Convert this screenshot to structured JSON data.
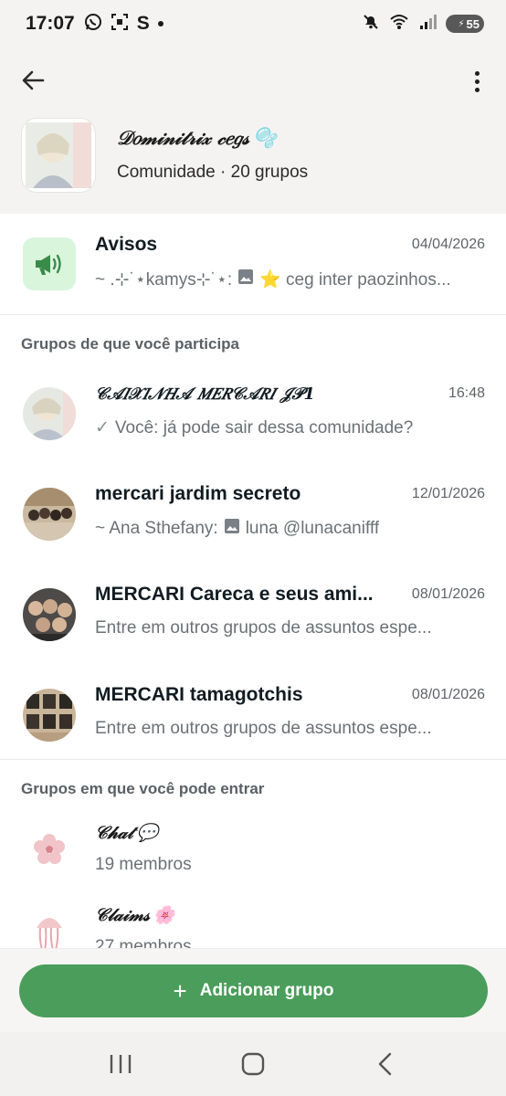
{
  "status_bar": {
    "time": "17:07",
    "left_icons": [
      "whatsapp-icon",
      "screenshot-icon",
      "s-icon",
      "dot-icon"
    ],
    "s_label": "S",
    "right_icons": [
      "mute-icon",
      "wifi-icon",
      "signal-icon"
    ],
    "battery": "55"
  },
  "header": {
    "community_name": "𝒟𝑜𝓂𝒾𝓃𝒾𝓉𝓇𝒾𝓍 𝒸𝑒𝑔𝓈",
    "community_emoji": "🫧",
    "subtitle": "Comunidade · 20 grupos"
  },
  "announcements": {
    "name": "Avisos",
    "date": "04/04/2026",
    "sender": "~ .⊹˙⋆kamys⊹˙⋆:",
    "message": "⭐ ceg inter paozinhos..."
  },
  "sections": {
    "participating_title": "Grupos de que você participa",
    "joinable_title": "Grupos em que você pode entrar"
  },
  "groups": [
    {
      "name": "𝒞𝒜𝐼𝒳𝐼𝒩𝐻𝒜 𝑀𝐸𝑅𝒞𝒜𝑅𝐼 𝒥𝒫1",
      "time": "16:48",
      "preview": "Você: já pode sair dessa comunidade?"
    },
    {
      "name": "mercari jardim secreto",
      "time": "12/01/2026",
      "preview_sender": "~ Ana Sthefany:",
      "preview": "luna @lunacanifff"
    },
    {
      "name": "MERCARI Careca e seus ami...",
      "time": "08/01/2026",
      "preview": "Entre em outros grupos de assuntos espe..."
    },
    {
      "name": "MERCARI tamagotchis",
      "time": "08/01/2026",
      "preview": "Entre em outros grupos de assuntos espe..."
    }
  ],
  "joinable": [
    {
      "name": "𝒞𝒽𝒶𝓉",
      "emoji": "💬",
      "members": "19 membros"
    },
    {
      "name": "𝒞𝓁𝒶𝒾𝓂𝓈",
      "emoji": "🌸",
      "members": "27 membros"
    }
  ],
  "actions": {
    "add_group": "Adicionar grupo"
  },
  "colors": {
    "accent": "#4a9d5a",
    "header_bg": "#f4f3f1",
    "announcement_icon_bg": "#d9f5dc",
    "announcement_icon": "#3a8a4a"
  }
}
